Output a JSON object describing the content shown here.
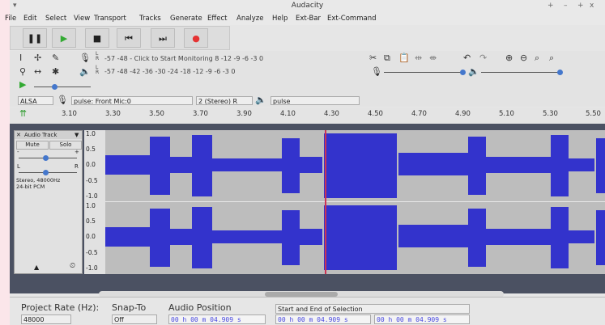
{
  "window": {
    "title": "Audacity",
    "controls": [
      "+",
      "–",
      "+",
      "x"
    ]
  },
  "menu": [
    "File",
    "Edit",
    "Select",
    "View",
    "Transport",
    "Tracks",
    "Generate",
    "Effect",
    "Analyze",
    "Help",
    "Ext-Bar",
    "Ext-Command"
  ],
  "transport": {
    "pause_icon": "pause-icon",
    "play_icon": "play-icon",
    "stop_icon": "stop-icon",
    "skip_start_icon": "skip-to-start-icon",
    "skip_end_icon": "skip-to-end-icon",
    "record_icon": "record-icon"
  },
  "meters": {
    "record_scale": "-57   -48  - Click to Start Monitoring 8  -12 -9 -6 -3 0",
    "play_scale": "-57   -48   -42   -36   -30   -24   -18   -12 -9 -6 -3 0",
    "lr_top": "L\nR",
    "lr_bottom": "L\nR"
  },
  "device": {
    "host": "ALSA",
    "input": "pulse: Front Mic:0",
    "channels": "2 (Stereo) R",
    "output": "pulse"
  },
  "ruler": {
    "ticks": [
      "3.10",
      "3.30",
      "3.50",
      "3.70",
      "3.90",
      "4.10",
      "4.30",
      "4.50",
      "4.70",
      "4.90",
      "5.10",
      "5.30",
      "5.50"
    ]
  },
  "track": {
    "name": "Audio Track",
    "mute": "Mute",
    "solo": "Solo",
    "gain_minus": "-",
    "gain_plus": "+",
    "pan_l": "L",
    "pan_r": "R",
    "info": "Stereo, 48000Hz\n24-bit PCM",
    "scale": [
      "1.0",
      "0.5",
      "0.0",
      "-0.5",
      "-1.0"
    ]
  },
  "selection_toolbar": {
    "project_rate_label": "Project Rate (Hz):",
    "project_rate_value": "48000",
    "snap_label": "Snap-To",
    "snap_value": "Off",
    "audio_position_label": "Audio Position",
    "audio_position_value": "00 h 00 m 04.909 s",
    "selection_mode": "Start and End of Selection",
    "sel_start": "00 h 00 m 04.909 s",
    "sel_end": "00 h 00 m 04.909 s"
  },
  "colors": {
    "wave": "#3333cc",
    "wave_bg": "#bdbdbd",
    "record": "#e53333",
    "play": "#33aa33",
    "cursor": "#cc3355"
  }
}
